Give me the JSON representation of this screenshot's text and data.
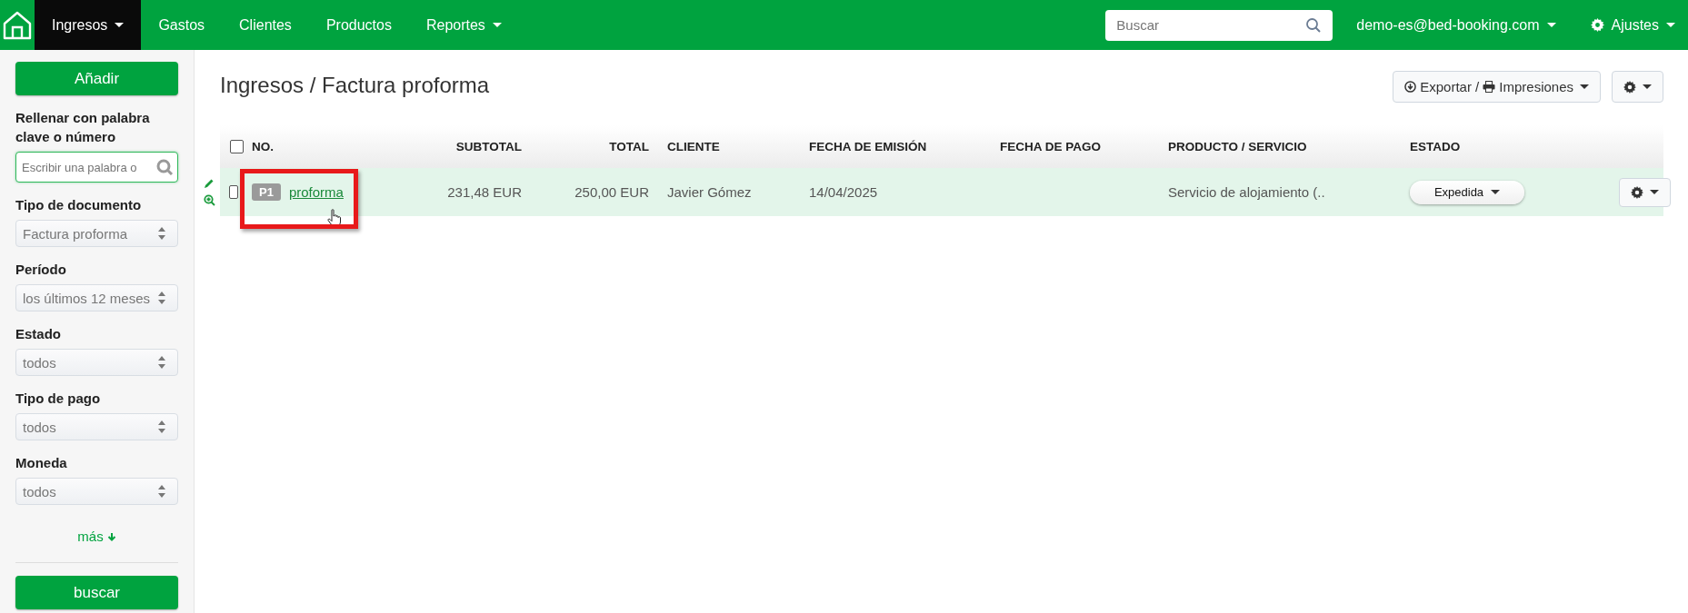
{
  "navbar": {
    "items": [
      {
        "label": "Ingresos",
        "selected": true,
        "dropdown": true
      },
      {
        "label": "Gastos",
        "selected": false,
        "dropdown": false
      },
      {
        "label": "Clientes",
        "selected": false,
        "dropdown": false
      },
      {
        "label": "Productos",
        "selected": false,
        "dropdown": false
      },
      {
        "label": "Reportes",
        "selected": false,
        "dropdown": true
      }
    ],
    "search": {
      "placeholder": "Buscar"
    },
    "user": "demo-es@bed-booking.com",
    "settings": "Ajustes"
  },
  "sidebar": {
    "add_button": "Añadir",
    "filters": [
      {
        "kind": "text",
        "label": "Rellenar con palabra clave o número",
        "placeholder": "Escribir una palabra o"
      },
      {
        "kind": "select",
        "label": "Tipo de documento",
        "value": "Factura proforma"
      },
      {
        "kind": "select",
        "label": "Período",
        "value": "los últimos 12 meses"
      },
      {
        "kind": "select",
        "label": "Estado",
        "value": "todos"
      },
      {
        "kind": "select",
        "label": "Tipo de pago",
        "value": "todos"
      },
      {
        "kind": "select",
        "label": "Moneda",
        "value": "todos"
      }
    ],
    "more_link": "más",
    "search_button": "buscar"
  },
  "page": {
    "title": "Ingresos / Factura proforma",
    "export_button": "Exportar / ",
    "print_label": "Impresiones"
  },
  "table": {
    "all_checked": false,
    "columns": [
      "NO.",
      "SUBTOTAL",
      "TOTAL",
      "CLIENTE",
      "FECHA DE EMISIÓN",
      "FECHA DE PAGO",
      "PRODUCTO / SERVICIO",
      "ESTADO"
    ],
    "rows": [
      {
        "checked": false,
        "badge": "P1",
        "number": "proforma",
        "subtotal": "231,48 EUR",
        "total": "250,00 EUR",
        "client": "Javier Gómez",
        "issue_date": "14/04/2025",
        "payment_date": "",
        "product": "Servicio de alojamiento (..",
        "status": "Expedida",
        "highlighted": true
      }
    ]
  }
}
